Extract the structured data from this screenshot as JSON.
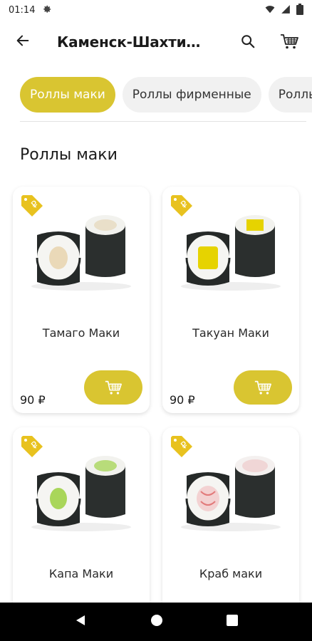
{
  "status_bar": {
    "time": "01:14"
  },
  "toolbar": {
    "title": "Каменск-Шахтин..."
  },
  "categories": [
    {
      "label": "Роллы маки",
      "active": true
    },
    {
      "label": "Роллы фирменные",
      "active": false
    },
    {
      "label": "Роллы",
      "active": false
    }
  ],
  "section": {
    "title": "Роллы маки"
  },
  "products": [
    {
      "name": "Тамаго Маки",
      "price": "90 ₽",
      "filling": "tamago"
    },
    {
      "name": "Такуан Маки",
      "price": "90 ₽",
      "filling": "takuan"
    },
    {
      "name": "Капа Маки",
      "price": "",
      "filling": "kappa"
    },
    {
      "name": "Краб маки",
      "price": "",
      "filling": "crab"
    }
  ],
  "colors": {
    "accent": "#d9c531",
    "badge": "#e8c21f",
    "chip_bg": "#f1f1f1",
    "nori": "#2b2f2e"
  },
  "icons": {
    "back": "arrow-back-icon",
    "search": "search-icon",
    "cart": "cart-icon",
    "badge": "ruble-tag-icon",
    "add": "cart-add-icon"
  }
}
